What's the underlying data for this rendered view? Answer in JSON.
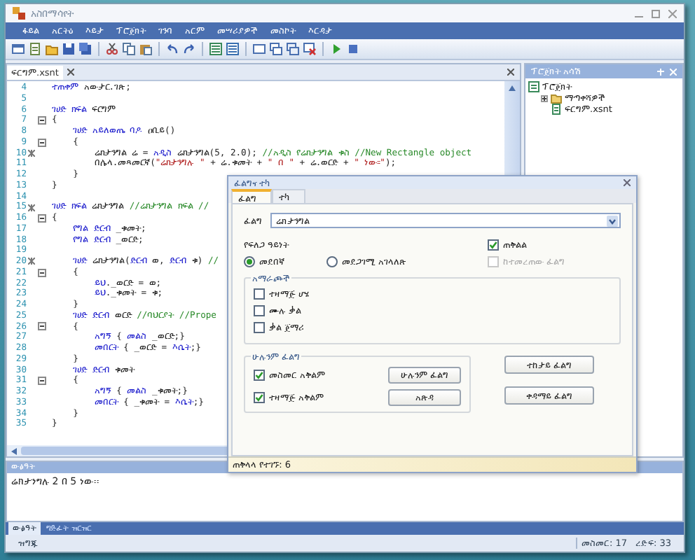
{
  "window": {
    "title": "አስበማሳየት"
  },
  "menu": [
    "ፋይል",
    "አርትዕ",
    "እይታ",
    "ፕሮጀክት",
    "ገንባ",
    "አርም",
    "መሣሪያዎች",
    "መስኮት",
    "እርዳታ"
  ],
  "document_tab": {
    "label": "ፍርግም.xsnt",
    "selected": true
  },
  "editor": {
    "lines": [
      {
        "number": "4",
        "fold": false,
        "marked": false,
        "segments": [
          {
            "kind": "keyword",
            "text": "ተጠቀም"
          },
          {
            "kind": "plain",
            "text": " አውታር.ገጽ;"
          }
        ]
      },
      {
        "number": "5",
        "fold": false,
        "marked": false
      },
      {
        "number": "6",
        "fold": false,
        "marked": false,
        "segments": [
          {
            "kind": "keyword",
            "text": "ገሀድ ክፍል"
          },
          {
            "kind": "plain",
            "text": " ፍርግም"
          }
        ]
      },
      {
        "number": "7",
        "fold": true,
        "marked": false,
        "segments": [
          {
            "kind": "plain",
            "text": "{"
          }
        ]
      },
      {
        "number": "8",
        "fold": false,
        "marked": false,
        "segments": [
          {
            "kind": "keyword",
            "text": "    ገሀድ አይለወጤ ባዶ"
          },
          {
            "kind": "plain",
            "text": " ዐቢይ()"
          }
        ]
      },
      {
        "number": "9",
        "fold": true,
        "marked": false,
        "segments": [
          {
            "kind": "plain",
            "text": "    {"
          }
        ]
      },
      {
        "number": "10",
        "fold": false,
        "marked": true,
        "segments": [
          {
            "kind": "plain",
            "text": "        ሬክታንግል ሬ = "
          },
          {
            "kind": "keyword",
            "text": "አዲስ"
          },
          {
            "kind": "plain",
            "text": " ሬክታንግል(5, 2.0); "
          },
          {
            "kind": "comment",
            "text": "//አዲስ የሬክታንግል ቁስ //New Rectangle object"
          }
        ]
      },
      {
        "number": "11",
        "fold": false,
        "marked": false,
        "segments": [
          {
            "kind": "plain",
            "text": "        በሌላ.መጻመርኛ("
          },
          {
            "kind": "string",
            "text": "\"ሬክታንግሉ \""
          },
          {
            "kind": "plain",
            "text": " + ሬ.ቁመት + "
          },
          {
            "kind": "string",
            "text": "\" በ \""
          },
          {
            "kind": "plain",
            "text": " + ሬ.ወርድ + "
          },
          {
            "kind": "string",
            "text": "\" ነው፡፡\""
          },
          {
            "kind": "plain",
            "text": ");"
          }
        ]
      },
      {
        "number": "12",
        "fold": false,
        "marked": false,
        "segments": [
          {
            "kind": "plain",
            "text": "    }"
          }
        ]
      },
      {
        "number": "13",
        "fold": false,
        "marked": false,
        "segments": [
          {
            "kind": "plain",
            "text": "}"
          }
        ]
      },
      {
        "number": "14",
        "fold": false,
        "marked": false
      },
      {
        "number": "15",
        "fold": false,
        "marked": true,
        "segments": [
          {
            "kind": "keyword",
            "text": "ገሀድ ክፍል"
          },
          {
            "kind": "plain",
            "text": " ሬክታንግል "
          },
          {
            "kind": "comment",
            "text": "//ሬክታንግል ክፍል //"
          }
        ]
      },
      {
        "number": "16",
        "fold": true,
        "marked": false,
        "segments": [
          {
            "kind": "plain",
            "text": "{"
          }
        ]
      },
      {
        "number": "17",
        "fold": false,
        "marked": false,
        "segments": [
          {
            "kind": "keyword",
            "text": "    የግል ድርብ"
          },
          {
            "kind": "plain",
            "text": " _ቁመት;"
          }
        ]
      },
      {
        "number": "18",
        "fold": false,
        "marked": false,
        "segments": [
          {
            "kind": "keyword",
            "text": "    የግል ድርብ"
          },
          {
            "kind": "plain",
            "text": " _ወርድ;"
          }
        ]
      },
      {
        "number": "19",
        "fold": false,
        "marked": false
      },
      {
        "number": "20",
        "fold": false,
        "marked": true,
        "segments": [
          {
            "kind": "keyword",
            "text": "    ገሀድ"
          },
          {
            "kind": "plain",
            "text": " ሬክታንግል("
          },
          {
            "kind": "keyword",
            "text": "ድርብ"
          },
          {
            "kind": "plain",
            "text": " ወ, "
          },
          {
            "kind": "keyword",
            "text": "ድርብ"
          },
          {
            "kind": "plain",
            "text": " ቁ) "
          },
          {
            "kind": "comment",
            "text": "//"
          }
        ]
      },
      {
        "number": "21",
        "fold": true,
        "marked": false,
        "segments": [
          {
            "kind": "plain",
            "text": "    {"
          }
        ]
      },
      {
        "number": "22",
        "fold": false,
        "marked": false,
        "segments": [
          {
            "kind": "keyword",
            "text": "        ይህ"
          },
          {
            "kind": "plain",
            "text": "._ወርድ = ወ;"
          }
        ]
      },
      {
        "number": "23",
        "fold": false,
        "marked": false,
        "segments": [
          {
            "kind": "keyword",
            "text": "        ይህ"
          },
          {
            "kind": "plain",
            "text": "._ቁመት = ቁ;"
          }
        ]
      },
      {
        "number": "24",
        "fold": false,
        "marked": false,
        "segments": [
          {
            "kind": "plain",
            "text": "    }"
          }
        ]
      },
      {
        "number": "25",
        "fold": false,
        "marked": false,
        "segments": [
          {
            "kind": "keyword",
            "text": "    ገሀድ ድርብ"
          },
          {
            "kind": "plain",
            "text": " ወርድ "
          },
          {
            "kind": "comment",
            "text": "//ባህርያት //Prope"
          }
        ]
      },
      {
        "number": "26",
        "fold": true,
        "marked": false,
        "segments": [
          {
            "kind": "plain",
            "text": "    {"
          }
        ]
      },
      {
        "number": "27",
        "fold": false,
        "marked": false,
        "segments": [
          {
            "kind": "keyword",
            "text": "        አግኝ"
          },
          {
            "kind": "plain",
            "text": " { "
          },
          {
            "kind": "keyword",
            "text": "መልስ"
          },
          {
            "kind": "plain",
            "text": " _ወርድ;}"
          }
        ]
      },
      {
        "number": "28",
        "fold": false,
        "marked": false,
        "segments": [
          {
            "kind": "keyword",
            "text": "        መበርት"
          },
          {
            "kind": "plain",
            "text": " { _ወርድ = "
          },
          {
            "kind": "keyword",
            "text": "እሴት"
          },
          {
            "kind": "plain",
            "text": ";}"
          }
        ]
      },
      {
        "number": "29",
        "fold": false,
        "marked": false,
        "segments": [
          {
            "kind": "plain",
            "text": "    }"
          }
        ]
      },
      {
        "number": "30",
        "fold": false,
        "marked": false,
        "segments": [
          {
            "kind": "keyword",
            "text": "    ገሀድ ድርብ"
          },
          {
            "kind": "plain",
            "text": " ቁመት"
          }
        ]
      },
      {
        "number": "31",
        "fold": true,
        "marked": false,
        "segments": [
          {
            "kind": "plain",
            "text": "    {"
          }
        ]
      },
      {
        "number": "32",
        "fold": false,
        "marked": false,
        "segments": [
          {
            "kind": "keyword",
            "text": "        አግኝ"
          },
          {
            "kind": "plain",
            "text": " { "
          },
          {
            "kind": "keyword",
            "text": "መልስ"
          },
          {
            "kind": "plain",
            "text": " _ቁመት;}"
          }
        ]
      },
      {
        "number": "33",
        "fold": false,
        "marked": false,
        "segments": [
          {
            "kind": "keyword",
            "text": "        መበርት"
          },
          {
            "kind": "plain",
            "text": " { _ቁመት = "
          },
          {
            "kind": "keyword",
            "text": "እሴት"
          },
          {
            "kind": "plain",
            "text": ";}"
          }
        ]
      },
      {
        "number": "34",
        "fold": false,
        "marked": false,
        "segments": [
          {
            "kind": "plain",
            "text": "    }"
          }
        ]
      },
      {
        "number": "35",
        "fold": false,
        "marked": false,
        "segments": [
          {
            "kind": "plain",
            "text": "}"
          }
        ]
      }
    ]
  },
  "project_pane": {
    "title": "ፕሮጀክት አሳሽ",
    "tree": [
      {
        "label": "ፕሮጀክት",
        "kind": "project",
        "children": [
          {
            "label": "ማጣቀሻዎች",
            "kind": "folder",
            "expanded": false
          },
          {
            "label": "ፍርግም.xsnt",
            "kind": "file"
          }
        ]
      }
    ]
  },
  "dialog": {
    "title": "ፈልግና ተካ",
    "tabs": [
      {
        "label": "ፈልግ",
        "selected": true
      },
      {
        "label": "ተካ",
        "selected": false
      }
    ],
    "find_label": "ፈልግ",
    "find_value": "ሬክታንግል",
    "search_type_label": "የፍለጋ ዓይነት",
    "search_types": [
      {
        "label": "መደበኛ",
        "selected": true
      },
      {
        "label": "መደጋገሚ አገላለጽ",
        "selected": false
      }
    ],
    "side_options": [
      {
        "label": "ጠቅልል",
        "checked": true,
        "disabled": false
      },
      {
        "label": "ከተመረጠው ፈልግ",
        "checked": false,
        "disabled": true
      }
    ],
    "options_group": {
      "title": "አማራጮች",
      "items": [
        {
          "label": "ተዛማጅ ሆሄ",
          "checked": false
        },
        {
          "label": "ሙሉ ቃል",
          "checked": false
        },
        {
          "label": "ቃል ጀማሪ",
          "checked": false
        }
      ]
    },
    "find_all_group": {
      "title": "ሁሉንም ፈልግ",
      "items": [
        {
          "label": "መስመር አቅልም",
          "checked": true
        },
        {
          "label": "ተዛማጅ አቅልም",
          "checked": true
        }
      ],
      "buttons": [
        "ሁሉንም ፈልግ",
        "አጽዳ"
      ]
    },
    "buttons": [
      "ተከታይ ፈልግ",
      "ቀዳማይ ፈልግ"
    ],
    "status": "ጠቅላላ የተገኙ: 6"
  },
  "output": {
    "title": "ውፅዓት",
    "text": "ሬክታንግሉ 2 በ 5 ነው፡፡",
    "tabs": [
      {
        "label": "ውፅዓት",
        "selected": true
      },
      {
        "label": "ግድፈት ዝርዝር",
        "selected": false
      }
    ]
  },
  "status_bar": {
    "text": "ዝግጁ",
    "line": "መስመር: 17",
    "column": "ረድፍ: 33"
  }
}
